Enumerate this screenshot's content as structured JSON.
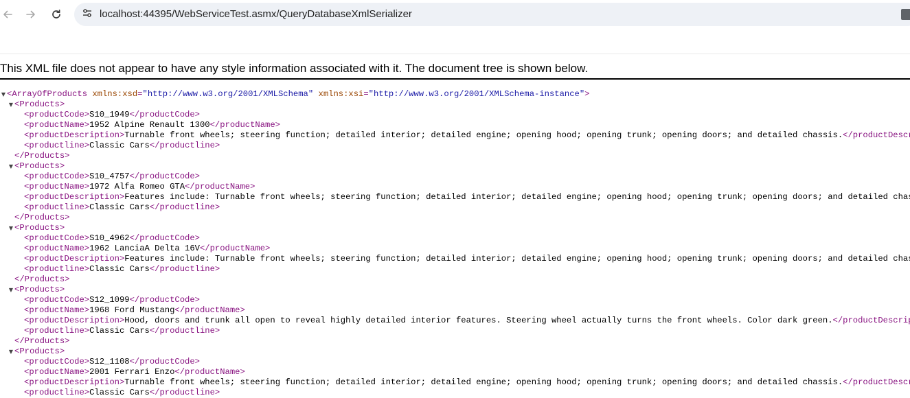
{
  "browser": {
    "url": "localhost:44395/WebServiceTest.asmx/QueryDatabaseXmlSerializer",
    "back_icon": "arrow-left-icon",
    "forward_icon": "arrow-right-icon",
    "reload_icon": "reload-icon",
    "site_info_icon": "tune-icon",
    "translate_icon": "translate-icon"
  },
  "notice": "This XML file does not appear to have any style information associated with it. The document tree is shown below.",
  "xml": {
    "root_open_tag": "<ArrayOfProducts",
    "root_attr1_name": "xmlns:xsd",
    "root_attr1_value": "\"http://www.w3.org/2001/XMLSchema\"",
    "root_attr2_name": "xmlns:xsi",
    "root_attr2_value": "\"http://www.w3.org/2001/XMLSchema-instance\"",
    "root_open_close": ">",
    "products_open": "<Products>",
    "products_close": "</Products>",
    "products": [
      {
        "code": "S10_1949",
        "name": "1952 Alpine Renault 1300",
        "description": "Turnable front wheels; steering function; detailed interior; detailed engine; opening hood; opening trunk; opening doors; and detailed chassis.",
        "line": "Classic Cars"
      },
      {
        "code": "S10_4757",
        "name": "1972 Alfa Romeo GTA",
        "description": "Features include: Turnable front wheels; steering function; detailed interior; detailed engine; opening hood; opening trunk; opening doors; and detailed chassis.",
        "line": "Classic Cars"
      },
      {
        "code": "S10_4962",
        "name": "1962 LanciaA Delta 16V",
        "description": "Features include: Turnable front wheels; steering function; detailed interior; detailed engine; opening hood; opening trunk; opening doors; and detailed chassis.",
        "line": "Classic Cars"
      },
      {
        "code": "S12_1099",
        "name": "1968 Ford Mustang",
        "description": "Hood, doors and trunk all open to reveal highly detailed interior features. Steering wheel actually turns the front wheels. Color dark green.",
        "line": "Classic Cars"
      },
      {
        "code": "S12_1108",
        "name": "2001 Ferrari Enzo",
        "description": "Turnable front wheels; steering function; detailed interior; detailed engine; opening hood; opening trunk; opening doors; and detailed chassis.",
        "line": "Classic Cars"
      }
    ],
    "tags": {
      "code_open": "<productCode>",
      "code_close": "</productCode>",
      "name_open": "<productName>",
      "name_close": "</productName>",
      "desc_open": "<productDescription>",
      "desc_close": "</productDescription>",
      "line_open": "<productline>",
      "line_close": "</productline>"
    }
  },
  "colors": {
    "tag": "#881280",
    "attr_name": "#994500",
    "attr_value": "#1a1aa6",
    "omnibox_bg": "#eef1f6"
  }
}
